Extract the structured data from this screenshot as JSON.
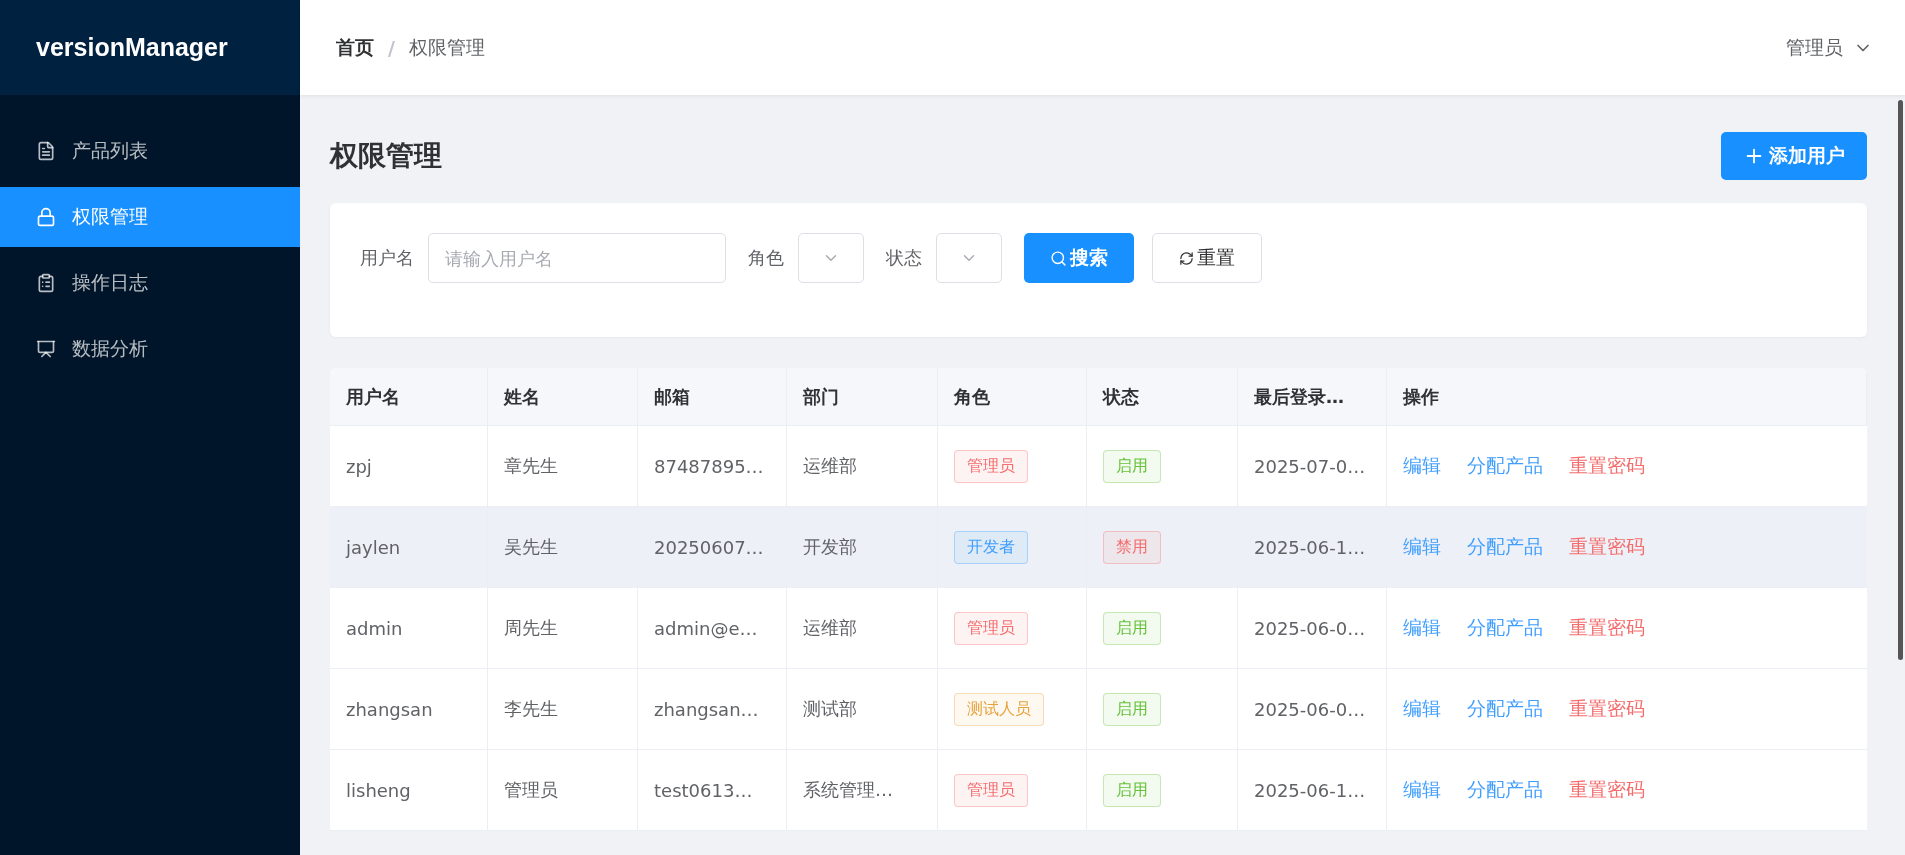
{
  "app": {
    "logo": "versionManager"
  },
  "sidebar": {
    "items": [
      {
        "label": "产品列表",
        "selected": false
      },
      {
        "label": "权限管理",
        "selected": true
      },
      {
        "label": "操作日志",
        "selected": false
      },
      {
        "label": "数据分析",
        "selected": false
      }
    ]
  },
  "header": {
    "breadcrumb": [
      "首页",
      "权限管理"
    ],
    "separator": "/",
    "user": "管理员"
  },
  "page": {
    "title": "权限管理",
    "add_button": "添加用户"
  },
  "filters": {
    "username_label": "用户名",
    "username_placeholder": "请输入用户名",
    "role_label": "角色",
    "status_label": "状态",
    "search_button": "搜索",
    "reset_button": "重置"
  },
  "table": {
    "columns": [
      "用户名",
      "姓名",
      "邮箱",
      "部门",
      "角色",
      "状态",
      "最后登录…",
      "操作"
    ],
    "rows": [
      {
        "username": "zpj",
        "name": "章先生",
        "email": "87487895…",
        "dept": "运维部",
        "role": {
          "text": "管理员",
          "color": "#f56c6c"
        },
        "status": {
          "text": "启用",
          "color": "#67c23a"
        },
        "last_login": "2025-07-0…",
        "selected": false,
        "actions": [
          {
            "label": "编辑",
            "kind": "primary"
          },
          {
            "label": "分配产品",
            "kind": "primary"
          },
          {
            "label": "重置密码",
            "kind": "danger"
          }
        ]
      },
      {
        "username": "jaylen",
        "name": "吴先生",
        "email": "20250607…",
        "dept": "开发部",
        "role": {
          "text": "开发者",
          "color": "#409eff"
        },
        "status": {
          "text": "禁用",
          "color": "#f56c6c"
        },
        "last_login": "2025-06-1…",
        "selected": true,
        "actions": [
          {
            "label": "编辑",
            "kind": "primary"
          },
          {
            "label": "分配产品",
            "kind": "primary"
          },
          {
            "label": "重置密码",
            "kind": "danger"
          }
        ]
      },
      {
        "username": "admin",
        "name": "周先生",
        "email": "admin@e…",
        "dept": "运维部",
        "role": {
          "text": "管理员",
          "color": "#f56c6c"
        },
        "status": {
          "text": "启用",
          "color": "#67c23a"
        },
        "last_login": "2025-06-0…",
        "selected": false,
        "actions": [
          {
            "label": "编辑",
            "kind": "primary"
          },
          {
            "label": "分配产品",
            "kind": "primary"
          },
          {
            "label": "重置密码",
            "kind": "danger"
          }
        ]
      },
      {
        "username": "zhangsan",
        "name": "李先生",
        "email": "zhangsan…",
        "dept": "测试部",
        "role": {
          "text": "测试人员",
          "color": "#e6a23c"
        },
        "status": {
          "text": "启用",
          "color": "#67c23a"
        },
        "last_login": "2025-06-0…",
        "selected": false,
        "actions": [
          {
            "label": "编辑",
            "kind": "primary"
          },
          {
            "label": "分配产品",
            "kind": "primary"
          },
          {
            "label": "重置密码",
            "kind": "danger"
          }
        ]
      },
      {
        "username": "lisheng",
        "name": "管理员",
        "email": "test0613…",
        "dept": "系统管理…",
        "role": {
          "text": "管理员",
          "color": "#f56c6c"
        },
        "status": {
          "text": "启用",
          "color": "#67c23a"
        },
        "last_login": "2025-06-1…",
        "selected": false,
        "actions": [
          {
            "label": "编辑",
            "kind": "primary"
          },
          {
            "label": "分配产品",
            "kind": "primary"
          },
          {
            "label": "重置密码",
            "kind": "danger"
          }
        ]
      }
    ]
  }
}
